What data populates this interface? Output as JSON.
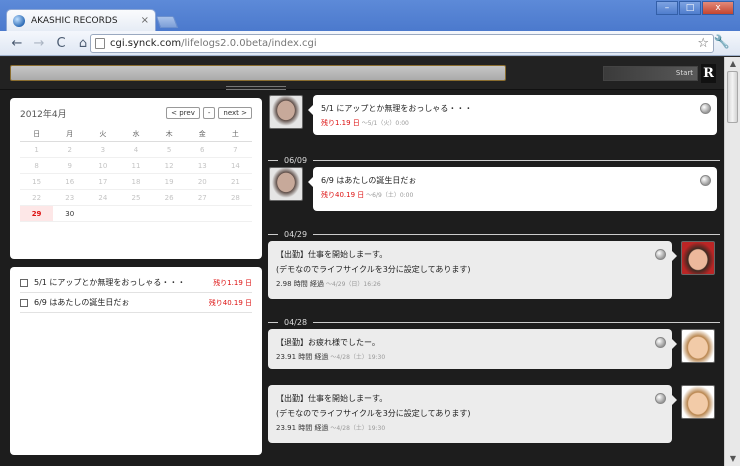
{
  "browser": {
    "tab_title": "AKASHIC RECORDS",
    "tab_close": "×",
    "url_host": "cgi.synck.com",
    "url_path": "/lifelogs2.0.0beta/index.cgi",
    "star": "☆",
    "wrench": "🔧",
    "back": "←",
    "forward": "→",
    "reload": "C",
    "home": "⌂",
    "minimize": "–",
    "maximize": "□",
    "close": "x"
  },
  "app": {
    "start_label": "Start",
    "logo": "R"
  },
  "calendar": {
    "title": "2012年4月",
    "prev": "< prev",
    "today": "-",
    "next": "next >",
    "weekdays": [
      "日",
      "月",
      "火",
      "水",
      "木",
      "金",
      "土"
    ],
    "weeks": [
      [
        "1",
        "2",
        "3",
        "4",
        "5",
        "6",
        "7"
      ],
      [
        "8",
        "9",
        "10",
        "11",
        "12",
        "13",
        "14"
      ],
      [
        "15",
        "16",
        "17",
        "18",
        "19",
        "20",
        "21"
      ],
      [
        "22",
        "23",
        "24",
        "25",
        "26",
        "27",
        "28"
      ],
      [
        "29",
        "30",
        "",
        "",
        "",
        "",
        ""
      ]
    ]
  },
  "todos": [
    {
      "text": "5/1 にアップとか無理をおっしゃる・・・",
      "remain": "残り1.19 日"
    },
    {
      "text": "6/9 はあたしの誕生日だぉ",
      "remain": "残り40.19 日"
    }
  ],
  "timeline": {
    "entries": [
      {
        "text": [
          "5/1 にアップとか無理をおっしゃる・・・"
        ],
        "remain": "残り1.19 日",
        "date": "～5/1（火）0:00"
      },
      {
        "divider": "06/09"
      },
      {
        "text": [
          "6/9 はあたしの誕生日だぉ"
        ],
        "remain": "残り40.19 日",
        "date": "～6/9（土）0:00"
      },
      {
        "divider": "04/29"
      },
      {
        "text": [
          "【出勤】仕事を開始しまーす。",
          "(デモなのでライフサイクルを3分に設定してあります)"
        ],
        "elapsed": "2.98 時間 経過",
        "date": "～4/29（日）16:26"
      },
      {
        "divider": "04/28"
      },
      {
        "text": [
          "【退勤】お疲れ様でしたー。"
        ],
        "elapsed": "23.91 時間 経過",
        "date": "～4/28（土）19:30"
      },
      {
        "text": [
          "【出勤】仕事を開始しまーす。",
          "(デモなのでライフサイクルを3分に設定してあります)"
        ],
        "elapsed": "23.91 時間 経過",
        "date": "～4/28（土）19:30"
      }
    ]
  }
}
